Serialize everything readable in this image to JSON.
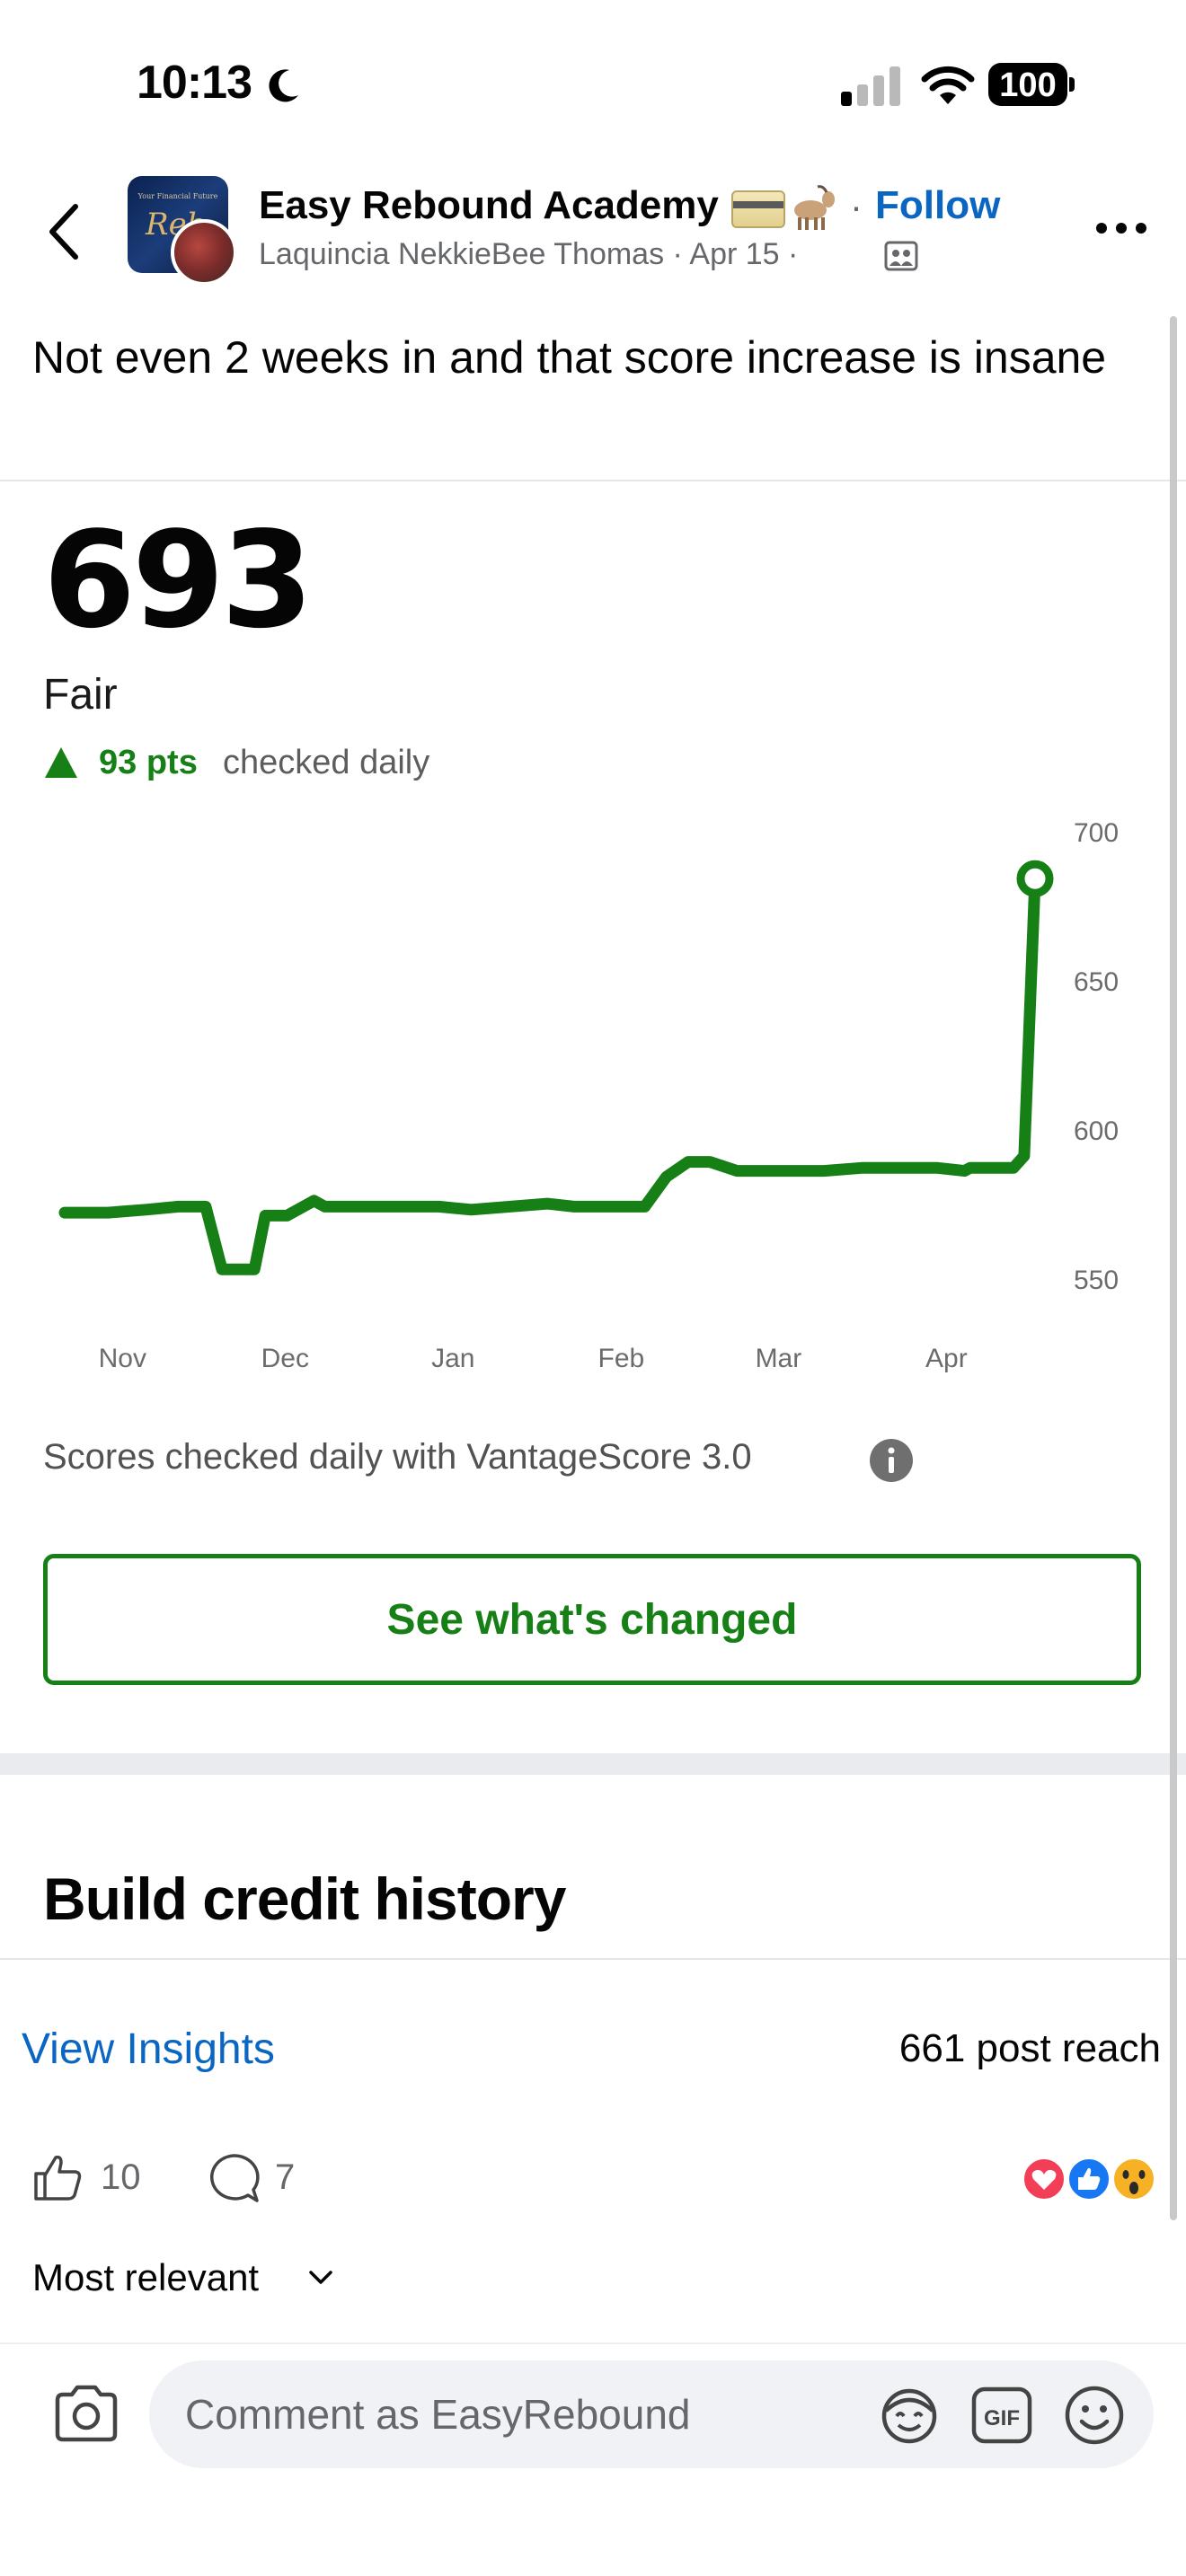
{
  "status_bar": {
    "time": "10:13",
    "battery": "100"
  },
  "post": {
    "page_name": "Easy Rebound Academy",
    "follow_separator": "·",
    "follow_label": "Follow",
    "author": "Laquincia NekkieBee Thomas",
    "date": "Apr 15",
    "author_line": "Laquincia NekkieBee Thomas · Apr 15 ·",
    "page_avatar_text": "Your Financial Future",
    "page_avatar_script": "Reb",
    "caption": "Not even 2 weeks in and that score increase is insane"
  },
  "credit_screen": {
    "score": "693",
    "rating": "Fair",
    "pts_change": "93 pts",
    "pts_note": "checked daily",
    "vantage_note": "Scores checked daily with VantageScore 3.0",
    "cta_label": "See what's changed",
    "section_heading": "Build credit history",
    "accent_color": "#168016"
  },
  "chart_data": {
    "type": "line",
    "x_tick_labels": [
      "Nov",
      "Dec",
      "Jan",
      "Feb",
      "Mar",
      "Apr"
    ],
    "y_tick_labels": [
      "700",
      "650",
      "600",
      "550"
    ],
    "ylim": [
      550,
      700
    ],
    "series": [
      {
        "values": [
          {
            "x": "Oct 23",
            "y": 581
          },
          {
            "x": "Oct 31",
            "y": 581
          },
          {
            "x": "Nov 7",
            "y": 582
          },
          {
            "x": "Nov 13",
            "y": 583
          },
          {
            "x": "Nov 18",
            "y": 583
          },
          {
            "x": "Nov 21",
            "y": 562
          },
          {
            "x": "Nov 27",
            "y": 562
          },
          {
            "x": "Nov 29",
            "y": 580
          },
          {
            "x": "Dec 3",
            "y": 580
          },
          {
            "x": "Dec 8",
            "y": 585
          },
          {
            "x": "Dec 10",
            "y": 583
          },
          {
            "x": "Dec 24",
            "y": 583
          },
          {
            "x": "Dec 31",
            "y": 583
          },
          {
            "x": "Jan 6",
            "y": 582
          },
          {
            "x": "Jan 20",
            "y": 584
          },
          {
            "x": "Jan 25",
            "y": 583
          },
          {
            "x": "Feb 7",
            "y": 583
          },
          {
            "x": "Feb 11",
            "y": 593
          },
          {
            "x": "Feb 15",
            "y": 598
          },
          {
            "x": "Feb 19",
            "y": 598
          },
          {
            "x": "Feb 24",
            "y": 595
          },
          {
            "x": "Mar 11",
            "y": 595
          },
          {
            "x": "Mar 18",
            "y": 596
          },
          {
            "x": "Apr 1",
            "y": 596
          },
          {
            "x": "Apr 6",
            "y": 595
          },
          {
            "x": "Apr 7",
            "y": 596
          },
          {
            "x": "Apr 15",
            "y": 596
          },
          {
            "x": "Apr 17",
            "y": 600
          },
          {
            "x": "Apr 19",
            "y": 693
          }
        ]
      }
    ],
    "grid": false,
    "endpoint_marker": "hollow-circle"
  },
  "insights": {
    "link_label": "View Insights",
    "reach": "661 post reach"
  },
  "engagement": {
    "likes": "10",
    "comments": "7"
  },
  "sort": {
    "label": "Most relevant"
  },
  "comment_box": {
    "placeholder": "Comment as EasyRebound"
  }
}
